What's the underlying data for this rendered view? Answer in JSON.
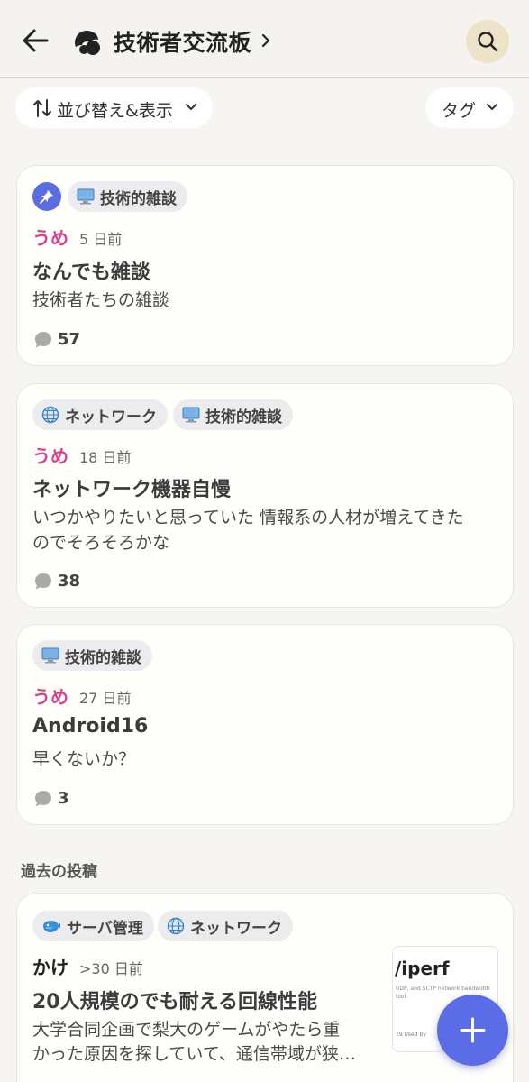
{
  "header": {
    "title": "技術者交流板",
    "back_icon": "back-arrow-icon",
    "board_icon": "community-icon",
    "search_icon": "search-icon"
  },
  "toolbar": {
    "sort_label": "並び替え&表示",
    "tag_label": "タグ"
  },
  "pinned_posts": [
    {
      "pinned": true,
      "tags": [
        {
          "label": "技術的雑談",
          "icon": "computer-icon"
        }
      ],
      "author": "うめ",
      "time": "5 日前",
      "title": "なんでも雑談",
      "body": "技術者たちの雑談",
      "comments": "57"
    },
    {
      "pinned": false,
      "tags": [
        {
          "label": "ネットワーク",
          "icon": "globe-icon"
        },
        {
          "label": "技術的雑談",
          "icon": "computer-icon"
        }
      ],
      "author": "うめ",
      "time": "18 日前",
      "title": "ネットワーク機器自慢",
      "body_line1": "いつかやりたいと思っていた 情報系の人材が増えてきた",
      "body_line2": "のでそろそろかな",
      "comments": "38"
    },
    {
      "pinned": false,
      "tags": [
        {
          "label": "技術的雑談",
          "icon": "computer-icon"
        }
      ],
      "author": "うめ",
      "time": "27 日前",
      "title": "Android16",
      "body": "早くないか？",
      "comments": "3"
    }
  ],
  "past_section": {
    "label": "過去の投稿",
    "posts": [
      {
        "tags": [
          {
            "label": "サーバ管理",
            "icon": "whale-icon"
          },
          {
            "label": "ネットワーク",
            "icon": "globe-icon"
          }
        ],
        "author": "かけ",
        "time": ">30 日前",
        "title": "20人規模のでも耐える回線性能",
        "body_line1": "大学合同企画で梨大のゲームがやたら重",
        "body_line2": "かった原因を探していて、通信帯域が狭…",
        "thumbnail": {
          "title": "/iperf",
          "desc": "UDP, and SCTP network bandwidth tool",
          "footer": "19  Used by"
        }
      }
    ]
  },
  "fab": {
    "icon": "plus-icon"
  },
  "colors": {
    "accent": "#5a6de6",
    "author": "#de3f8d",
    "background": "#f7f5f1",
    "search_bg": "#eee3c8"
  }
}
